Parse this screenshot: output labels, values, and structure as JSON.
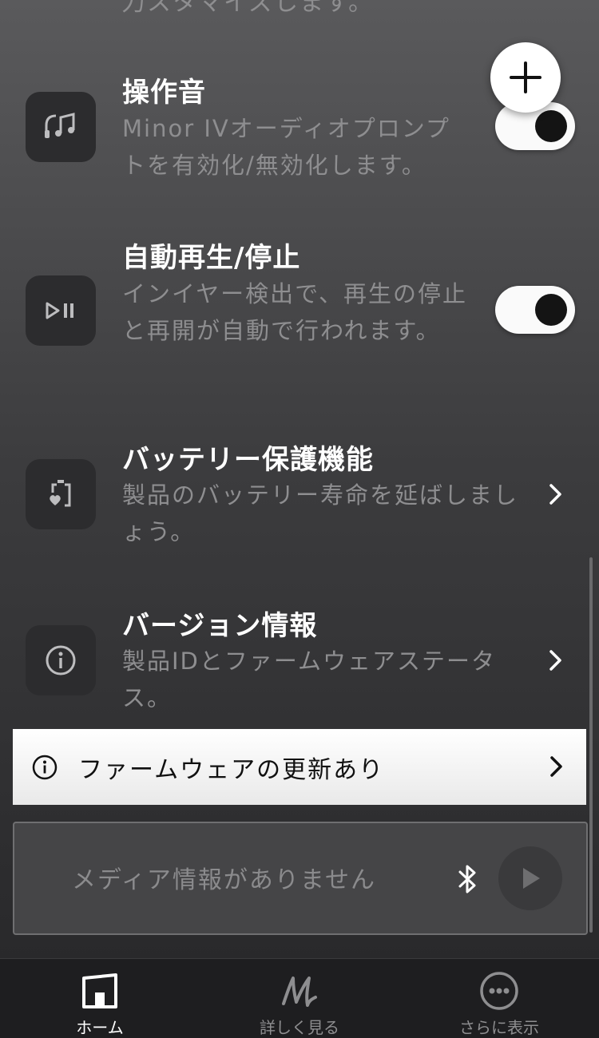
{
  "partial_text": "力スタマイズします。",
  "fab": {
    "icon": "plus-icon"
  },
  "settings": [
    {
      "icon": "music-note-icon",
      "title": "操作音",
      "description": "Minor IVオーディオプロンプトを有効化/無効化します。",
      "control": "toggle",
      "toggle_on": true
    },
    {
      "icon": "play-pause-icon",
      "title": "自動再生/停止",
      "description": "インイヤー検出で、再生の停止と再開が自動で行われます。",
      "control": "toggle",
      "toggle_on": true
    },
    {
      "icon": "battery-heart-icon",
      "title": "バッテリー保護機能",
      "description": "製品のバッテリー寿命を延ばしましょう。",
      "control": "chevron"
    },
    {
      "icon": "info-icon",
      "title": "バージョン情報",
      "description": "製品IDとファームウェアステータス。",
      "control": "chevron"
    }
  ],
  "firmware_banner": {
    "icon": "info-icon",
    "text": "ファームウェアの更新あり"
  },
  "player": {
    "text": "メディア情報がありません",
    "bluetooth_icon": "bluetooth-icon",
    "play_icon": "play-icon"
  },
  "tabs": [
    {
      "label": "ホーム",
      "icon": "home-icon",
      "active": true
    },
    {
      "label": "詳しく見る",
      "icon": "marshall-m-icon",
      "active": false
    },
    {
      "label": "さらに表示",
      "icon": "more-icon",
      "active": false
    }
  ],
  "colors": {
    "background_top": "#5a5a5c",
    "background_bottom": "#262628",
    "accent": "#ffffff"
  }
}
